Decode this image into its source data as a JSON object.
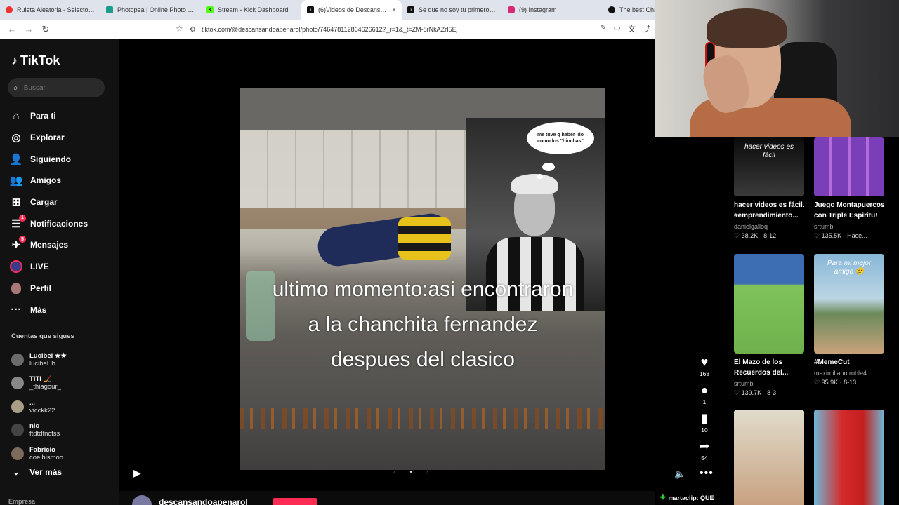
{
  "browser": {
    "tabs": [
      {
        "label": "Ruleta Aleatoria - Selector Pe...",
        "fav_color": "#e33"
      },
      {
        "label": "Photopea | Online Photo Editor",
        "fav_color": "#1a9c8a"
      },
      {
        "label": "Stream - Kick Dashboard",
        "fav_color": "#53fc18"
      },
      {
        "label": "(6)Videos de Descansand...",
        "fav_color": "#111"
      },
      {
        "label": "Se que no soy tu primero... | s...",
        "fav_color": "#111"
      },
      {
        "label": "(9) Instagram",
        "fav_color": "#d62976"
      },
      {
        "label": "The best Chat",
        "fav_color": "#111"
      }
    ],
    "active_tab_close": "×",
    "url": "tiktok.com/@descansandoapenarol/photo/74647811286462661​2?_r=1&_t=ZM-8rNkAZrI5Ej"
  },
  "tiktok": {
    "logo": "TikTok",
    "search_placeholder": "Buscar",
    "nav": [
      {
        "label": "Para ti",
        "icon": "home-icon"
      },
      {
        "label": "Explorar",
        "icon": "compass-icon"
      },
      {
        "label": "Siguiendo",
        "icon": "following-icon"
      },
      {
        "label": "Amigos",
        "icon": "friends-icon"
      },
      {
        "label": "Cargar",
        "icon": "upload-icon"
      },
      {
        "label": "Notificaciones",
        "icon": "bell-icon",
        "badge": "1"
      },
      {
        "label": "Mensajes",
        "icon": "message-icon",
        "badge": "5"
      },
      {
        "label": "LIVE",
        "icon": "live-icon"
      },
      {
        "label": "Perfil",
        "icon": "profile-icon"
      },
      {
        "label": "Más",
        "icon": "more-icon"
      }
    ],
    "following_header": "Cuentas que sigues",
    "accounts": [
      {
        "name": "Lucibel ★★",
        "handle": "lucibel.lb"
      },
      {
        "name": "TITI 🏒",
        "handle": "_thiagour_"
      },
      {
        "name": "...",
        "handle": "vicckk22"
      },
      {
        "name": "nic",
        "handle": "ftdtdfncfss"
      },
      {
        "name": "Fabricio",
        "handle": "coelhismoo"
      }
    ],
    "see_more": "Ver más",
    "company": "Empresa"
  },
  "post": {
    "bubble_text": "me tuve q haber ido como los \"hinchas\"",
    "caption": "ultimo momento:asi encontraron a la chanchita fernandez despues del clasico",
    "likes": "168",
    "comments": "1",
    "saves": "10",
    "shares": "54",
    "author": "descansandoapenarol"
  },
  "suggested": [
    {
      "title": "hacer videos es fácil. #emprendimiento...",
      "user": "danielgalloq",
      "meta": "♡ 38.2K · 8-12",
      "thumb_text": "hacer videos es fácil"
    },
    {
      "title": "Juego Montapuercos con Triple Espiritu!",
      "user": "srtumbi",
      "meta": "♡ 135.5K · Hace...",
      "thumb_text": ""
    },
    {
      "title": "El Mazo de los Recuerdos del...",
      "user": "srtumbi",
      "meta": "♡ 139.7K · 8-3",
      "thumb_text": ""
    },
    {
      "title": "#MemeCut",
      "user": "maximiliano.roble4",
      "meta": "♡ 95.9K · 8-13",
      "thumb_text": "Para mi mejor amigo 🥲"
    }
  ],
  "chat_overlay": "martaclip: QUE"
}
